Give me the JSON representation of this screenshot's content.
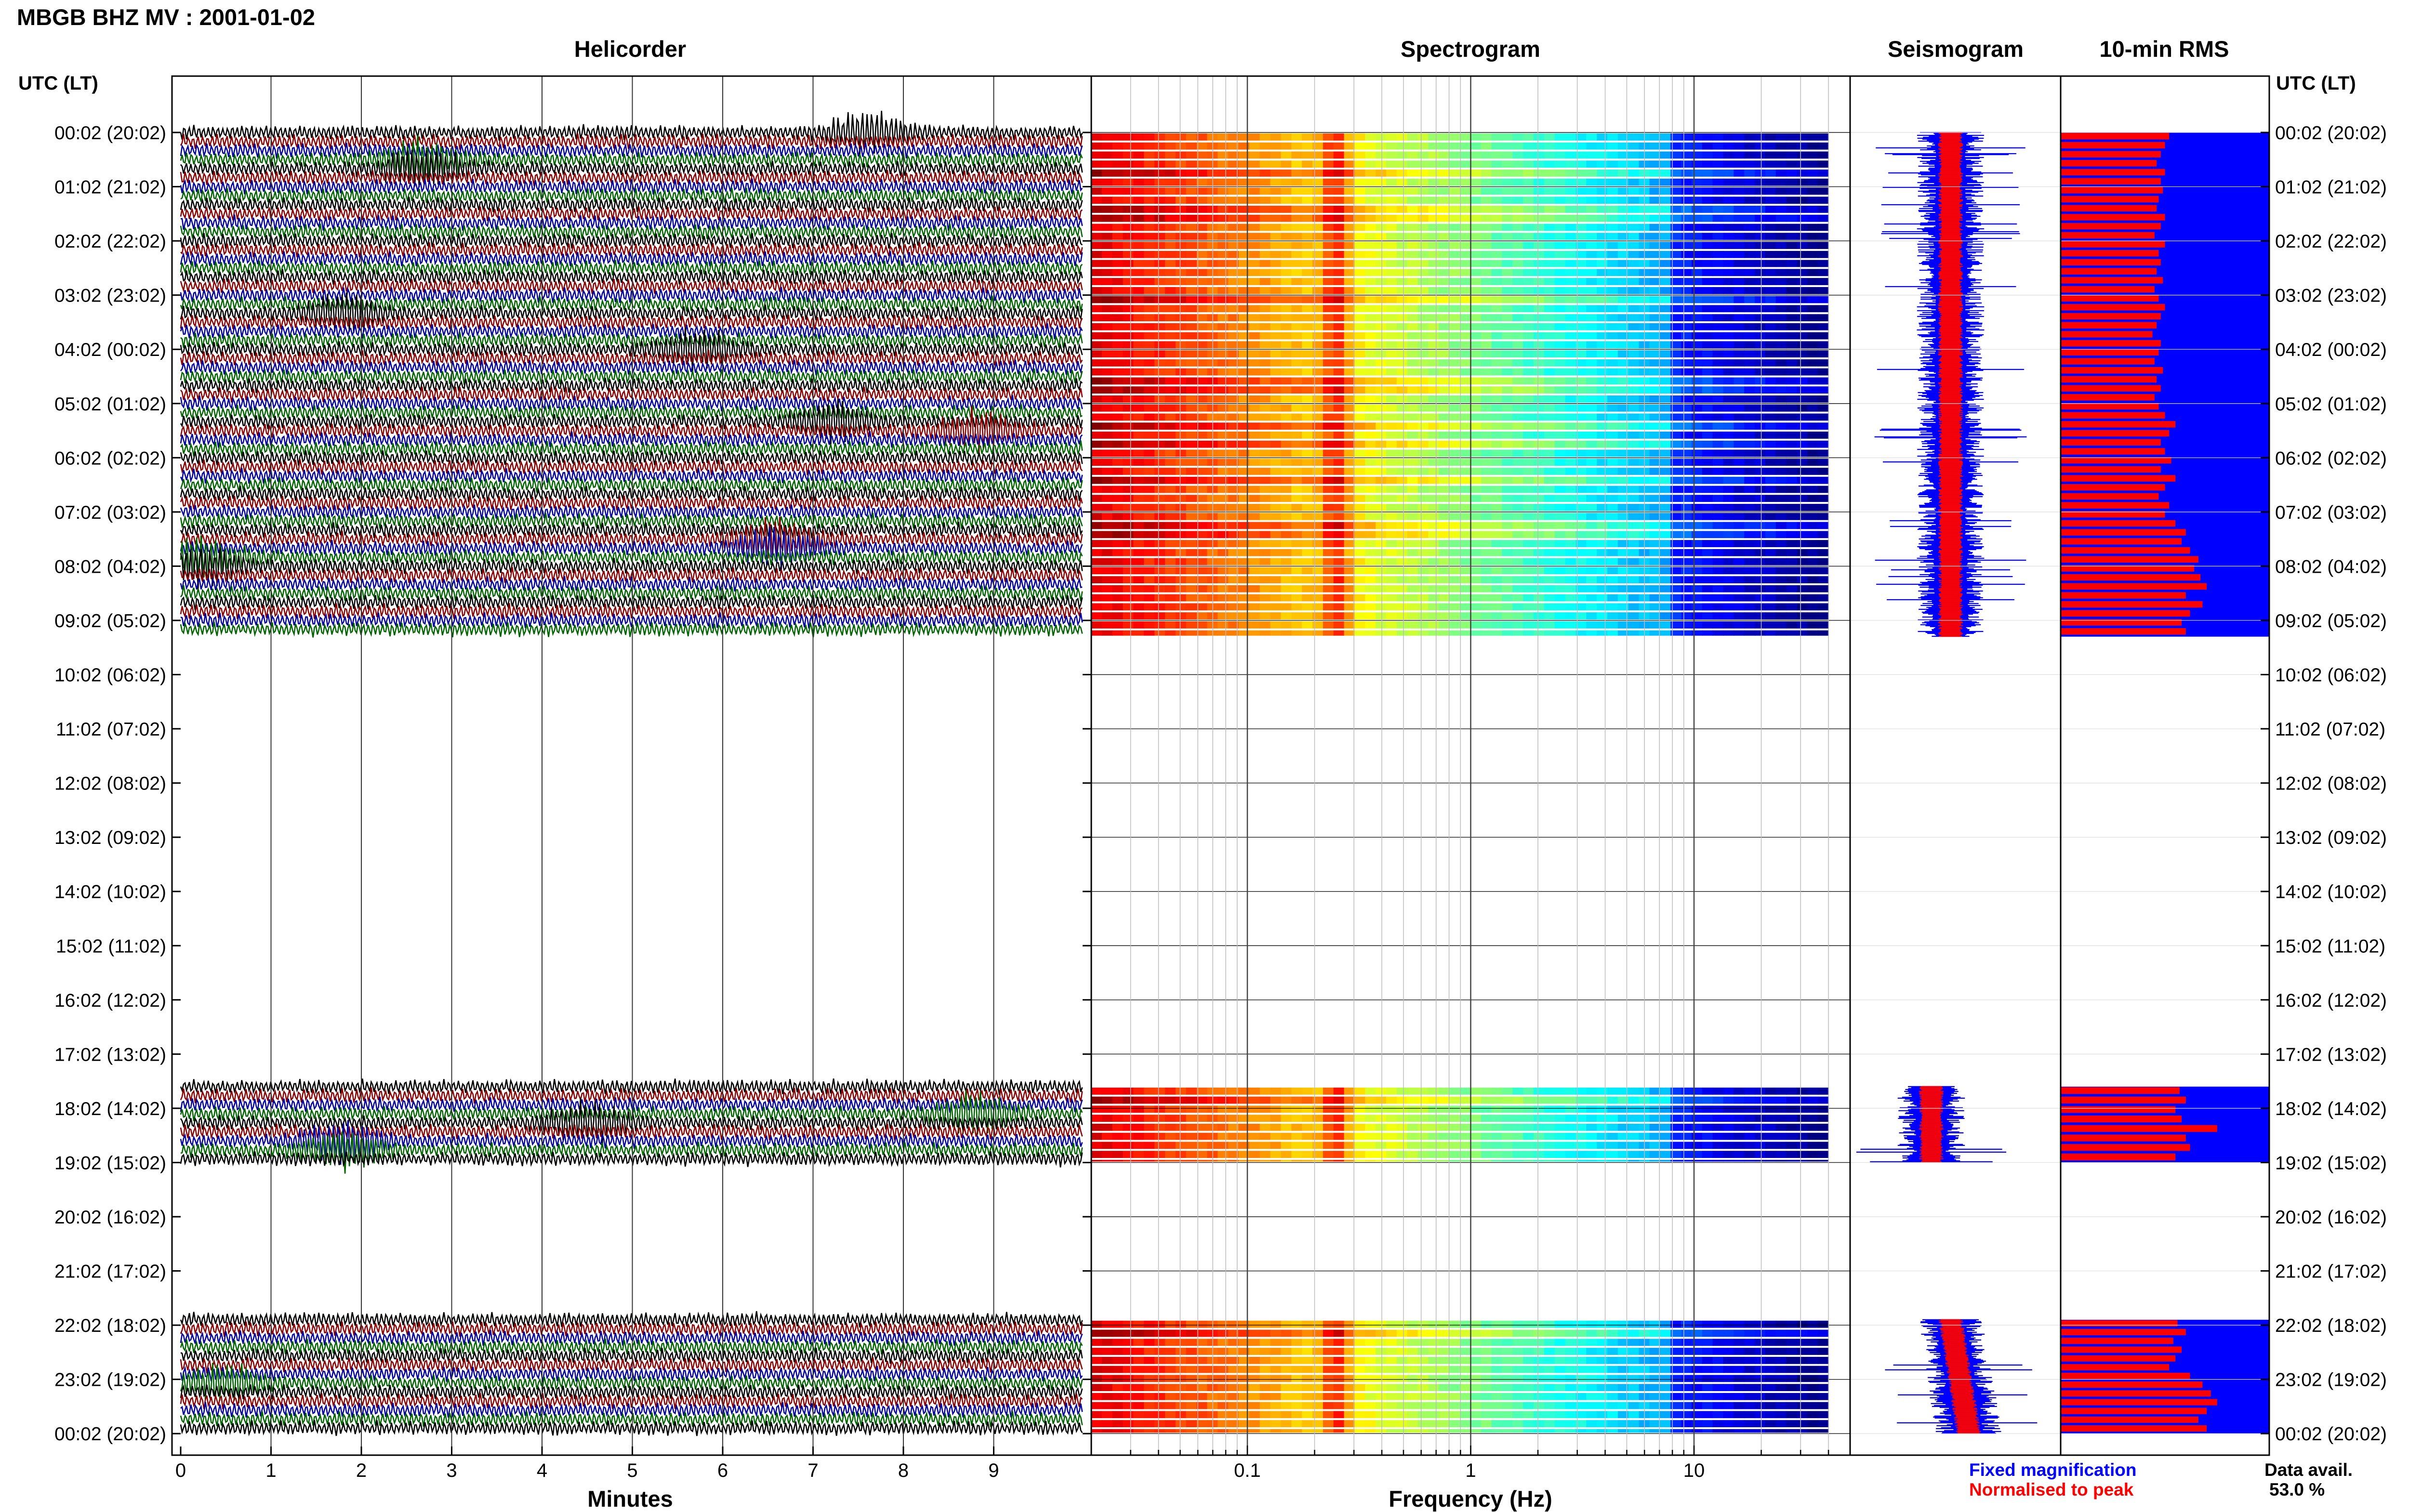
{
  "header": {
    "title": "MBGB BHZ MV : 2001-01-02"
  },
  "colors": {
    "trace_black": "#000000",
    "trace_red": "#8b0000",
    "trace_blue": "#0000a0",
    "trace_green": "#006400",
    "spec_low": "#00007f",
    "spec_high": "#ff0000",
    "rms_fixed": "#0000ff",
    "rms_norm": "#ff0000",
    "gridline": "#000000"
  },
  "panels": {
    "helicorder_title": "Helicorder",
    "spectrogram_title": "Spectrogram",
    "seismogram_title": "Seismogram",
    "rms_title": "10-min RMS",
    "left_axis_title": "UTC (LT)",
    "right_axis_title": "UTC (LT)"
  },
  "legend": {
    "fixed": "Fixed magnification",
    "normalised": "Normalised to peak"
  },
  "availability": {
    "label": "Data avail.",
    "value": "53.0 %"
  },
  "chart_data": {
    "type": "heatmap",
    "title": "MBGB BHZ MV : 2001-01-02",
    "time_axis": {
      "labels": [
        "00:02 (20:02)",
        "01:02 (21:02)",
        "02:02 (22:02)",
        "03:02 (23:02)",
        "04:02 (00:02)",
        "05:02 (01:02)",
        "06:02 (02:02)",
        "07:02 (03:02)",
        "08:02 (04:02)",
        "09:02 (05:02)",
        "10:02 (06:02)",
        "11:02 (07:02)",
        "12:02 (08:02)",
        "13:02 (09:02)",
        "14:02 (10:02)",
        "15:02 (11:02)",
        "16:02 (12:02)",
        "17:02 (13:02)",
        "18:02 (14:02)",
        "19:02 (15:02)",
        "20:02 (16:02)",
        "21:02 (17:02)",
        "22:02 (18:02)",
        "23:02 (19:02)",
        "00:02 (20:02)"
      ],
      "data_segments_hours": [
        [
          0,
          9.3
        ],
        [
          17.6,
          19.0
        ],
        [
          21.9,
          24.0
        ]
      ]
    },
    "helicorder": {
      "xlabel": "Minutes",
      "xticks": [
        0,
        1,
        2,
        3,
        4,
        5,
        6,
        7,
        8,
        9
      ],
      "xlim": [
        0,
        10
      ],
      "lines_per_hour": 6,
      "events": [
        {
          "hour": 0.0,
          "minute": 7.6,
          "color": "black"
        },
        {
          "hour": 0.6,
          "minute": 2.7,
          "color": "blue"
        },
        {
          "hour": 3.3,
          "minute": 1.8,
          "color": "red"
        },
        {
          "hour": 4.0,
          "minute": 5.7,
          "color": "black"
        },
        {
          "hour": 5.5,
          "minute": 8.8,
          "color": "green"
        },
        {
          "hour": 5.3,
          "minute": 7.2,
          "color": "red"
        },
        {
          "hour": 7.6,
          "minute": 6.6,
          "color": "blue"
        },
        {
          "hour": 7.9,
          "minute": 0.2,
          "color": "black"
        },
        {
          "hour": 18.3,
          "minute": 4.5,
          "color": "blue"
        },
        {
          "hour": 18.1,
          "minute": 8.8,
          "color": "blue"
        },
        {
          "hour": 18.7,
          "minute": 1.8,
          "color": "red"
        },
        {
          "hour": 23.1,
          "minute": 0.5,
          "color": "green"
        }
      ]
    },
    "spectrogram": {
      "xlabel": "Frequency (Hz)",
      "scale": "log",
      "xlim": [
        0.02,
        50
      ],
      "xticks": [
        0.1,
        1,
        10
      ],
      "xtick_labels": [
        "0.1",
        "1",
        "10"
      ],
      "microseism_peak_hz": 0.25,
      "fmax_data_hz": 40
    },
    "seismogram": {
      "fixed_half_width": [
        0.22,
        0.28,
        0.22,
        0.22,
        0.22,
        0.24,
        0.3,
        0.24,
        0.3,
        0.28,
        0.6,
        0.34,
        0.3
      ]
    },
    "rms": {
      "series": [
        {
          "name": "Normalised to peak",
          "segment": "00:02-09:20",
          "values": [
            0.52,
            0.5,
            0.48,
            0.46,
            0.5,
            0.48,
            0.49,
            0.47,
            0.46,
            0.5,
            0.48,
            0.45,
            0.5,
            0.47,
            0.48,
            0.46,
            0.49,
            0.45,
            0.47,
            0.5,
            0.48,
            0.46,
            0.44,
            0.48,
            0.47,
            0.45,
            0.49,
            0.46,
            0.48,
            0.45,
            0.47,
            0.5,
            0.55,
            0.52,
            0.48,
            0.5,
            0.53,
            0.48,
            0.55,
            0.5,
            0.47,
            0.52,
            0.5,
            0.55,
            0.6,
            0.58,
            0.62,
            0.66,
            0.64,
            0.67,
            0.7,
            0.6,
            0.68,
            0.62,
            0.58,
            0.6
          ]
        },
        {
          "name": "Normalised to peak",
          "segment": "17:38-19:00",
          "values": [
            0.57,
            0.6,
            0.55,
            0.58,
            0.75,
            0.6,
            0.62,
            0.55
          ]
        },
        {
          "name": "Normalised to peak",
          "segment": "21:55-24:00",
          "values": [
            0.56,
            0.6,
            0.54,
            0.58,
            0.55,
            0.52,
            0.62,
            0.68,
            0.72,
            0.75,
            0.7,
            0.66,
            0.7
          ]
        }
      ]
    }
  }
}
